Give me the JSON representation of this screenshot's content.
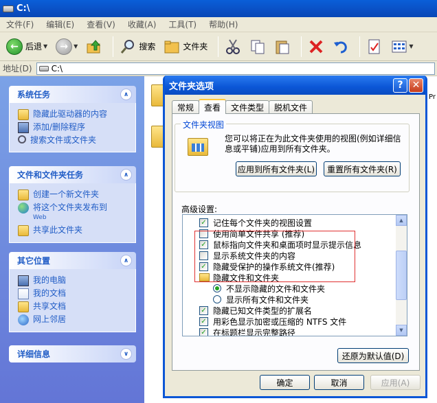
{
  "explorer": {
    "title": "C:\\",
    "menu": [
      "文件(F)",
      "编辑(E)",
      "查看(V)",
      "收藏(A)",
      "工具(T)",
      "帮助(H)"
    ],
    "toolbar": {
      "back": "后退",
      "search": "搜索",
      "folders": "文件夹"
    },
    "address": {
      "label": "地址(D)",
      "value": "C:\\"
    },
    "trail_text": "Pr",
    "panels": [
      {
        "title": "系统任务",
        "items": [
          "隐藏此驱动器的内容",
          "添加/删除程序",
          "搜索文件或文件夹"
        ]
      },
      {
        "title": "文件和文件夹任务",
        "items": [
          "创建一个新文件夹",
          "将这个文件夹发布到",
          "共享此文件夹"
        ],
        "web_sub": "Web"
      },
      {
        "title": "其它位置",
        "items": [
          "我的电脑",
          "我的文档",
          "共享文档",
          "网上邻居"
        ]
      },
      {
        "title": "详细信息"
      }
    ]
  },
  "dialog": {
    "title": "文件夹选项",
    "tabs": [
      "常规",
      "查看",
      "文件类型",
      "脱机文件"
    ],
    "folder_view": {
      "legend": "文件夹视图",
      "description": "您可以将正在为此文件夹使用的视图(例如详细信息或平铺)应用到所有文件夹。",
      "apply_all": "应用到所有文件夹(L)",
      "reset_all": "重置所有文件夹(R)"
    },
    "advanced_label": "高级设置:",
    "settings": [
      {
        "type": "check",
        "checked": true,
        "label": "记住每个文件夹的视图设置"
      },
      {
        "type": "check",
        "checked": false,
        "label": "使用简单文件共享 (推荐)"
      },
      {
        "type": "check",
        "checked": true,
        "label": "鼠标指向文件夹和桌面项时显示提示信息"
      },
      {
        "type": "check",
        "checked": false,
        "label": "显示系统文件夹的内容"
      },
      {
        "type": "check",
        "checked": true,
        "label": "隐藏受保护的操作系统文件(推荐)"
      },
      {
        "type": "folder",
        "label": "隐藏文件和文件夹"
      },
      {
        "type": "radio",
        "checked": true,
        "label": "不显示隐藏的文件和文件夹"
      },
      {
        "type": "radio",
        "checked": false,
        "label": "显示所有文件和文件夹"
      },
      {
        "type": "check",
        "checked": true,
        "label": "隐藏已知文件类型的扩展名"
      },
      {
        "type": "check",
        "checked": true,
        "label": "用彩色显示加密或压缩的 NTFS 文件"
      },
      {
        "type": "check",
        "checked": true,
        "label": "在标题栏显示完整路径"
      }
    ],
    "restore_defaults": "还原为默认值(D)",
    "ok": "确定",
    "cancel": "取消",
    "apply": "应用(A)"
  }
}
